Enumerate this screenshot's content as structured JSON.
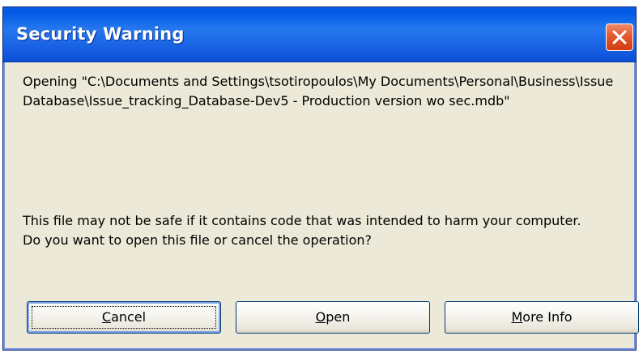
{
  "window": {
    "title": "Security Warning"
  },
  "message": {
    "opening_text": "Opening \"C:\\Documents and Settings\\tsotiropoulos\\My Documents\\Personal\\Business\\Issue Database\\Issue_tracking_Database-Dev5 - Production version wo sec.mdb\"",
    "warning_line1": "This file may not be safe if it contains code that was intended to harm your computer.",
    "warning_line2": "Do you want to open this file or cancel the operation?"
  },
  "buttons": {
    "cancel": {
      "mnemonic": "C",
      "rest": "ancel"
    },
    "open": {
      "mnemonic": "O",
      "rest": "pen"
    },
    "more_info": {
      "mnemonic": "M",
      "rest": "ore Info"
    }
  },
  "colors": {
    "title_bar": "#2678ef",
    "close_button": "#e35a32",
    "dialog_background": "#ece9d8"
  },
  "icons": {
    "close": "close-icon"
  }
}
